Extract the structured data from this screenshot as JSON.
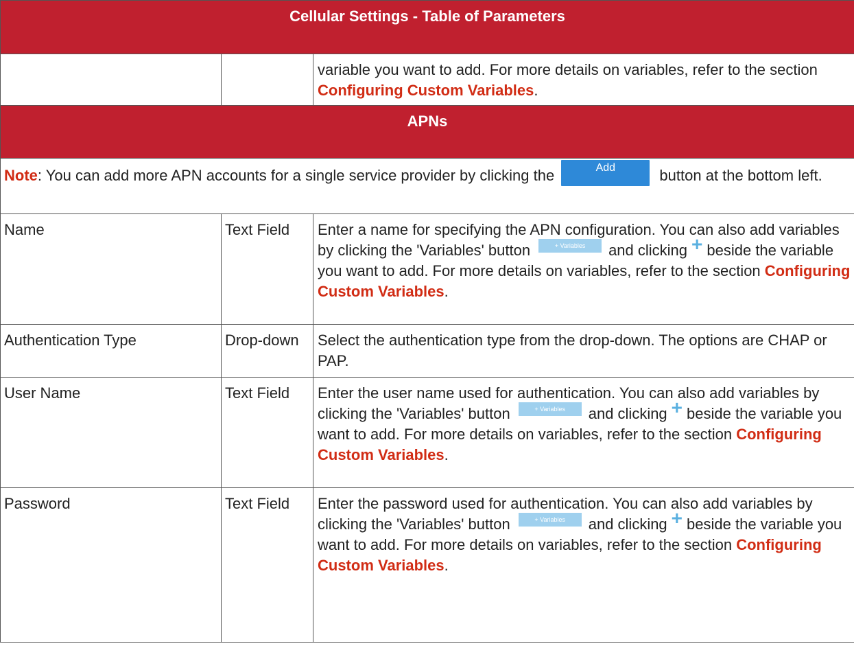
{
  "header": {
    "title": "Cellular Settings - Table of Parameters"
  },
  "continuation": {
    "text": "variable you want to add. For more details on variables, refer to the section ",
    "link": "Configuring Custom Variables",
    "end": "."
  },
  "apns": {
    "title": "APNs",
    "note": {
      "label": "Note",
      "text_before": ": You can add more APN accounts for a single service provider by clicking the ",
      "button_label": "Add",
      "text_after": " button at the bottom left."
    },
    "rows": [
      {
        "name": "Name",
        "type": "Text Field",
        "desc_before": "Enter a name for specifying the APN configuration. You can also add variables by clicking the 'Variables' button",
        "desc_mid": "and clicking",
        "desc_after": "beside the variable you want to add. For more details on variables, refer to the section ",
        "link": "Configuring Custom Variables",
        "end": "."
      },
      {
        "name": "Authentication Type",
        "type": "Drop-down",
        "desc": "Select the authentication type from the drop-down. The options are CHAP or PAP."
      },
      {
        "name": "User Name",
        "type": "Text Field",
        "desc_before": "Enter the user name used for authentication. You can also add variables by clicking the 'Variables' button",
        "desc_mid": "and clicking",
        "desc_after": "beside the variable you want to add. For more details on variables, refer to the section ",
        "link": "Configuring Custom Variables",
        "end": "."
      },
      {
        "name": "Password",
        "type": "Text Field",
        "desc_before": "Enter the password used for authentication. You can also add variables by clicking the 'Variables' button",
        "desc_mid": "and clicking",
        "desc_after": "beside the variable you want to add. For more details on variables, refer to the section ",
        "link": "Configuring Custom Variables",
        "end": "."
      }
    ]
  },
  "variables_button_label": "+ Variables",
  "plus_glyph": "+",
  "colors": {
    "header_bg": "#c0202f",
    "link": "#d12c14",
    "add_button": "#2e89d8",
    "variables_button": "#9fd0ee"
  }
}
